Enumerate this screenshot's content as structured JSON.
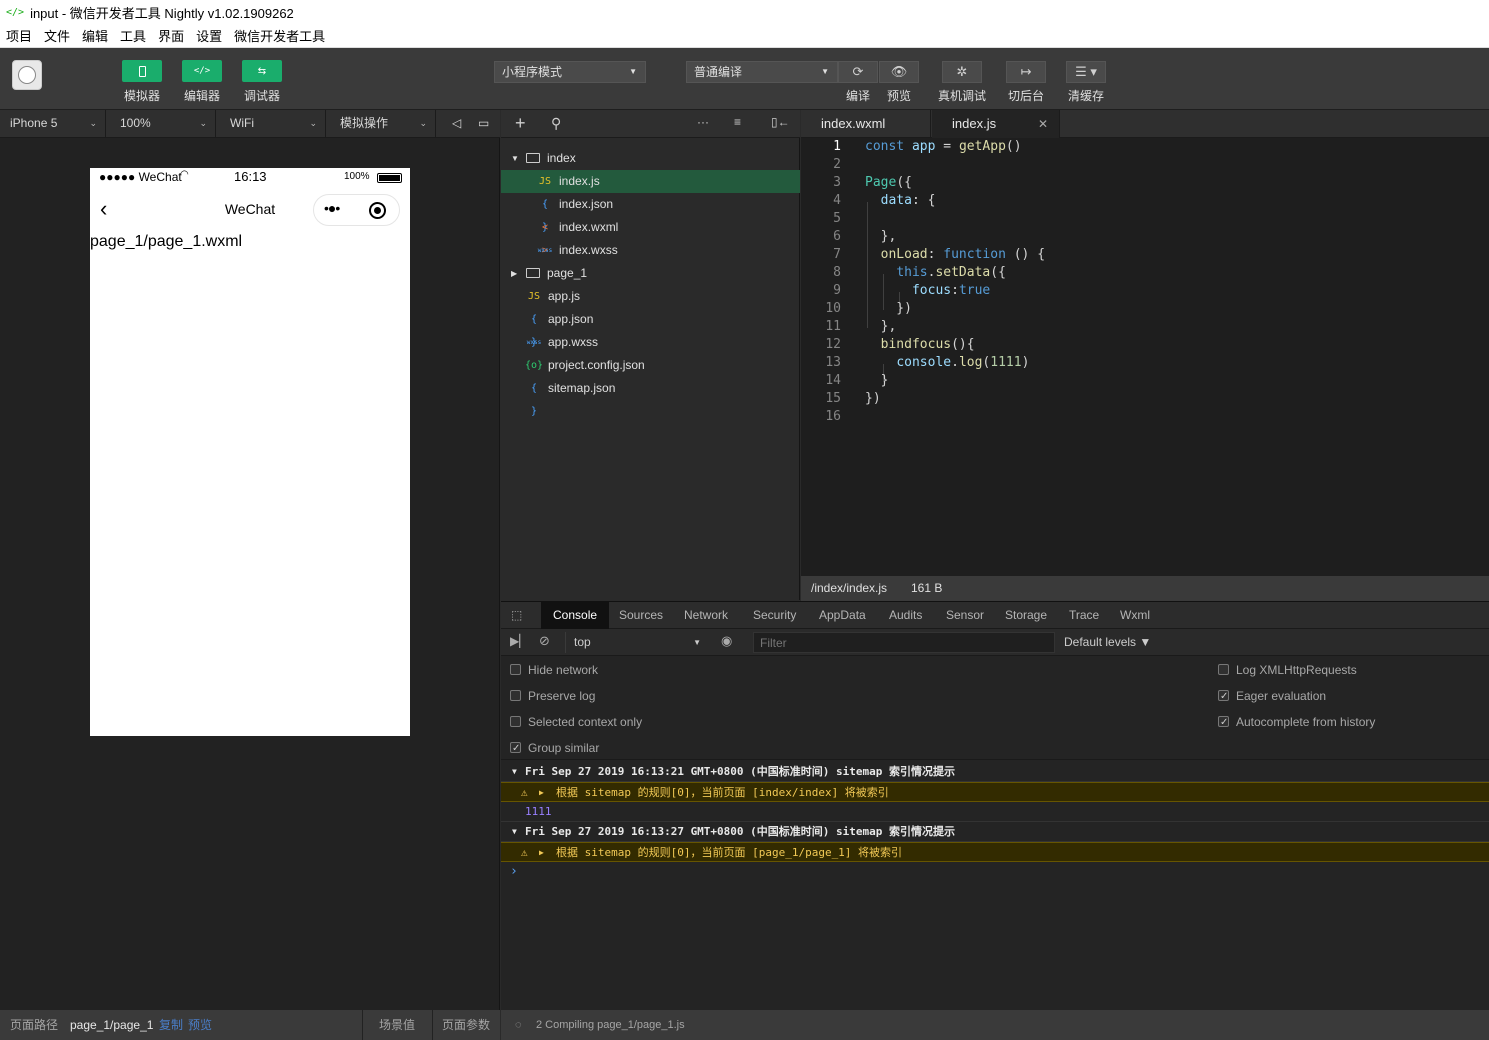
{
  "window": {
    "title": "input - 微信开发者工具 Nightly v1.02.1909262"
  },
  "menu": [
    "项目",
    "文件",
    "编辑",
    "工具",
    "界面",
    "设置",
    "微信开发者工具"
  ],
  "toolbar": {
    "simulator_label": "模拟器",
    "editor_label": "编辑器",
    "debugger_label": "调试器",
    "mode_select": "小程序模式",
    "compile_select": "普通编译",
    "compile_label": "编译",
    "preview_label": "预览",
    "remote_debug_label": "真机调试",
    "background_label": "切后台",
    "clear_cache_label": "清缓存"
  },
  "device_bar": {
    "device": "iPhone 5",
    "zoom": "100%",
    "network": "WiFi",
    "operation": "模拟操作"
  },
  "phone": {
    "carrier": "●●●●● WeChat",
    "time": "16:13",
    "battery": "100%",
    "nav_title": "WeChat",
    "content": "page_1/page_1.wxml"
  },
  "file_tree": [
    {
      "name": "index",
      "type": "folder-open",
      "depth": 0
    },
    {
      "name": "index.js",
      "type": "js",
      "depth": 1,
      "selected": true
    },
    {
      "name": "index.json",
      "type": "json",
      "depth": 1
    },
    {
      "name": "index.wxml",
      "type": "wxml",
      "depth": 1
    },
    {
      "name": "index.wxss",
      "type": "wxss",
      "depth": 1
    },
    {
      "name": "page_1",
      "type": "folder-closed",
      "depth": 0
    },
    {
      "name": "app.js",
      "type": "js",
      "depth": 0
    },
    {
      "name": "app.json",
      "type": "json",
      "depth": 0
    },
    {
      "name": "app.wxss",
      "type": "wxss",
      "depth": 0
    },
    {
      "name": "project.config.json",
      "type": "config",
      "depth": 0
    },
    {
      "name": "sitemap.json",
      "type": "json",
      "depth": 0
    }
  ],
  "file_icons": {
    "js": "JS",
    "json": "{ }",
    "wxml": "< >",
    "wxss": "wxss",
    "config": "{o}"
  },
  "editor": {
    "tabs": [
      {
        "label": "index.wxml",
        "active": false
      },
      {
        "label": "index.js",
        "active": true
      }
    ],
    "close_glyph": "✕",
    "line_numbers": [
      "1",
      "2",
      "3",
      "4",
      "5",
      "6",
      "7",
      "8",
      "9",
      "10",
      "11",
      "12",
      "13",
      "14",
      "15",
      "16"
    ],
    "file_path": "/index/index.js",
    "file_size": "161 B"
  },
  "devtools": {
    "tabs": [
      "Console",
      "Sources",
      "Network",
      "Security",
      "AppData",
      "Audits",
      "Sensor",
      "Storage",
      "Trace",
      "Wxml"
    ],
    "context": "top",
    "filter_placeholder": "Filter",
    "levels": "Default levels ▼",
    "options_left": [
      {
        "label": "Hide network",
        "checked": false
      },
      {
        "label": "Preserve log",
        "checked": false
      },
      {
        "label": "Selected context only",
        "checked": false
      },
      {
        "label": "Group similar",
        "checked": true
      }
    ],
    "options_right": [
      {
        "label": "Log XMLHttpRequests",
        "checked": false
      },
      {
        "label": "Eager evaluation",
        "checked": true
      },
      {
        "label": "Autocomplete from history",
        "checked": true
      }
    ],
    "console": {
      "group1": "Fri Sep 27 2019 16:13:21 GMT+0800 (中国标准时间) sitemap 索引情况提示",
      "warn1": "根据 sitemap 的规则[0]，当前页面 [index/index] 将被索引",
      "log1": "1111",
      "group2": "Fri Sep 27 2019 16:13:27 GMT+0800 (中国标准时间) sitemap 索引情况提示",
      "warn2": "根据 sitemap 的规则[0]，当前页面 [page_1/page_1] 将被索引",
      "prompt": "›"
    }
  },
  "sim_status": {
    "path_label": "页面路径",
    "path": "page_1/page_1",
    "copy": "复制",
    "preview": "预览",
    "scene": "场景值",
    "params": "页面参数"
  },
  "dev_status": {
    "text": "2 Compiling page_1/page_1.js"
  },
  "colors": {
    "accent_green": "#1aad6c",
    "selected_row": "#235a3d",
    "warn_text": "#f2c955",
    "log_value": "#9980ff"
  }
}
